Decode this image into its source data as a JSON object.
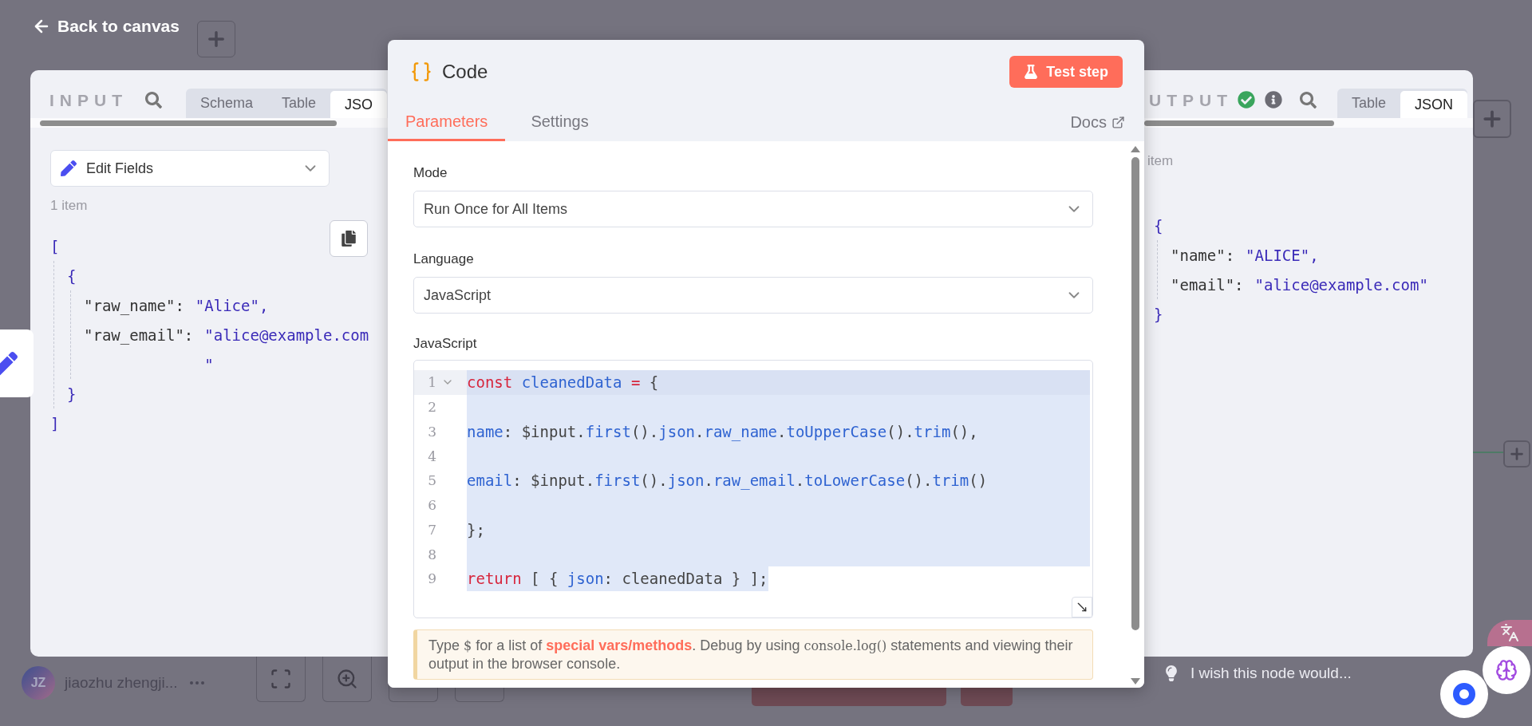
{
  "header": {
    "back_link": "Back to canvas"
  },
  "input_panel": {
    "title": "INPUT",
    "tabs": [
      {
        "label": "Schema",
        "selected": false
      },
      {
        "label": "Table",
        "selected": false
      },
      {
        "label": "JSO",
        "selected": true
      }
    ],
    "node_select": "Edit Fields",
    "item_count": "1 item",
    "json": {
      "open": "[",
      "close": "]",
      "children": [
        {
          "open": "{",
          "close": "}",
          "children": [
            {
              "key": "\"raw_name\":",
              "value": "\"Alice\","
            },
            {
              "key": "\"raw_email\":",
              "value": "\"alice@example.com",
              "value_wrap": "\""
            }
          ]
        }
      ]
    }
  },
  "output_panel": {
    "title": "UTPUT",
    "tabs": [
      {
        "label": "Table",
        "selected": false
      },
      {
        "label": "JSON",
        "selected": true
      }
    ],
    "item_count": "item",
    "json": {
      "open": "{",
      "close": "}",
      "children": [
        {
          "key": "\"name\":",
          "value": "\"ALICE\","
        },
        {
          "key": "\"email\":",
          "value": "\"alice@example.com\""
        }
      ]
    }
  },
  "modal": {
    "title": "Code",
    "test_button": "Test step",
    "tabs": [
      {
        "label": "Parameters",
        "selected": true
      },
      {
        "label": "Settings",
        "selected": false
      }
    ],
    "docs_link": "Docs",
    "fields": [
      {
        "label": "Mode",
        "value": "Run Once for All Items"
      },
      {
        "label": "Language",
        "value": "JavaScript"
      }
    ],
    "editor": {
      "label": "JavaScript",
      "lines": [
        {
          "number": "1",
          "active": true,
          "selected": true,
          "tokens": [
            {
              "text": "const",
              "kind": "keyword"
            },
            {
              "text": " cleanedData",
              "kind": "name"
            },
            {
              "text": " = ",
              "kind": "keyword"
            },
            {
              "text": "{",
              "kind": "plain"
            }
          ]
        },
        {
          "number": "2",
          "active": false,
          "selected": true
        },
        {
          "number": "3",
          "active": false,
          "selected": true,
          "tokens": [
            {
              "text": "name",
              "kind": "name"
            },
            {
              "text": ": $input.",
              "kind": "plain"
            },
            {
              "text": "first",
              "kind": "name"
            },
            {
              "text": "().",
              "kind": "plain"
            },
            {
              "text": "json",
              "kind": "name"
            },
            {
              "text": ".",
              "kind": "plain"
            },
            {
              "text": "raw_name",
              "kind": "name"
            },
            {
              "text": ".",
              "kind": "plain"
            },
            {
              "text": "toUpperCase",
              "kind": "name"
            },
            {
              "text": "().",
              "kind": "plain"
            },
            {
              "text": "trim",
              "kind": "name"
            },
            {
              "text": "(),",
              "kind": "plain"
            }
          ]
        },
        {
          "number": "4",
          "active": false,
          "selected": true
        },
        {
          "number": "5",
          "active": false,
          "selected": true,
          "tokens": [
            {
              "text": "email",
              "kind": "name"
            },
            {
              "text": ": $input.",
              "kind": "plain"
            },
            {
              "text": "first",
              "kind": "name"
            },
            {
              "text": "().",
              "kind": "plain"
            },
            {
              "text": "json",
              "kind": "name"
            },
            {
              "text": ".",
              "kind": "plain"
            },
            {
              "text": "raw_email",
              "kind": "name"
            },
            {
              "text": ".",
              "kind": "plain"
            },
            {
              "text": "toLowerCase",
              "kind": "name"
            },
            {
              "text": "().",
              "kind": "plain"
            },
            {
              "text": "trim",
              "kind": "name"
            },
            {
              "text": "()",
              "kind": "plain"
            }
          ]
        },
        {
          "number": "6",
          "active": false,
          "selected": true
        },
        {
          "number": "7",
          "active": false,
          "selected": true,
          "tokens": [
            {
              "text": "};",
              "kind": "plain"
            }
          ]
        },
        {
          "number": "8",
          "active": false,
          "selected": true
        },
        {
          "number": "9",
          "active": false,
          "selected": true,
          "tokens": [
            {
              "text": "return",
              "kind": "keyword"
            },
            {
              "text": " [ { ",
              "kind": "plain"
            },
            {
              "text": "json",
              "kind": "name"
            },
            {
              "text": ": cleanedData } ];",
              "kind": "plain"
            }
          ]
        }
      ]
    },
    "hint": [
      {
        "text": "Type ",
        "kind": "text"
      },
      {
        "text": "$",
        "kind": "code"
      },
      {
        "text": " for a list of ",
        "kind": "text"
      },
      {
        "text": "special vars/methods",
        "kind": "link"
      },
      {
        "text": ". Debug by using ",
        "kind": "text"
      },
      {
        "text": "console.log()",
        "kind": "code"
      },
      {
        "text": " statements and viewing their output in the browser console.",
        "kind": "text"
      }
    ]
  },
  "footer": {
    "user": {
      "initials": "JZ",
      "name": "jiaozhu zhengji..."
    },
    "feedback": "I wish this node would..."
  }
}
